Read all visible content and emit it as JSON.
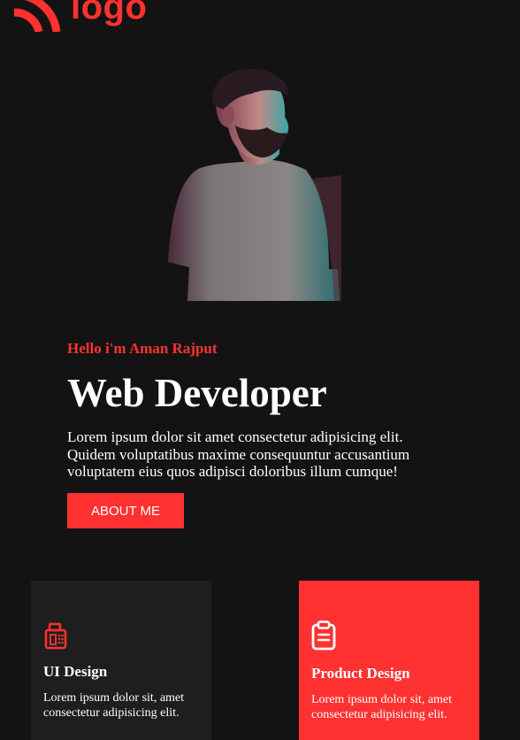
{
  "brand": {
    "logo_text": "logo"
  },
  "hero": {
    "greeting": "Hello i'm Aman Rajput",
    "title": "Web Developer",
    "description": "Lorem ipsum dolor sit amet consectetur adipisicing elit. Quidem voluptatibus maxime consequuntur accusantium voluptatem eius quos adipisci doloribus illum cumque!",
    "cta_label": "ABOUT ME"
  },
  "services": [
    {
      "icon": "fax-machine-icon",
      "title": "UI Design",
      "text": "Lorem ipsum dolor sit, amet consectetur adipisicing elit."
    },
    {
      "icon": "clipboard-icon",
      "title": "Product Design",
      "text": "Lorem ipsum dolor sit, amet consectetur adipisicing elit."
    }
  ],
  "colors": {
    "background": "#131313",
    "accent": "#ff3131",
    "card_dark": "#1e1e1e",
    "text": "#ffffff"
  }
}
